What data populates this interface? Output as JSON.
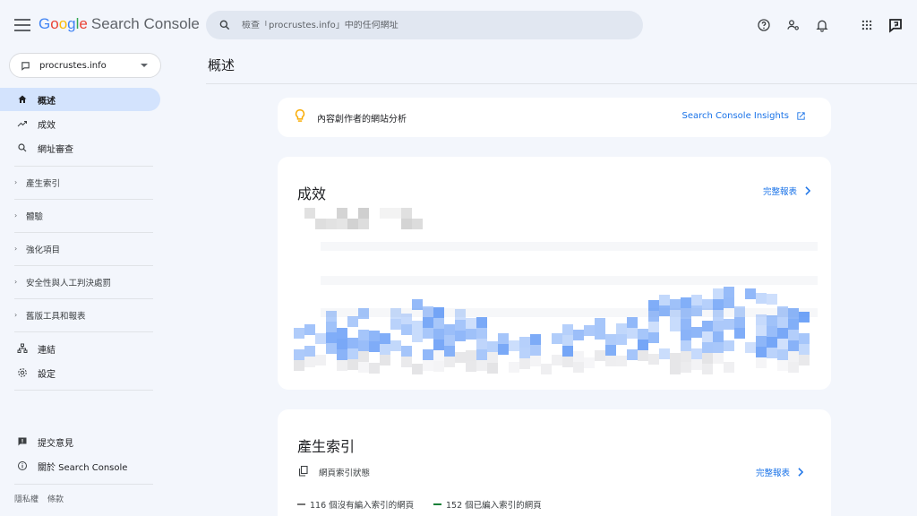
{
  "header": {
    "logo": {
      "g": "G",
      "o1": "o",
      "o2": "o",
      "g2": "g",
      "l": "l",
      "e": "e",
      "product": "Search Console"
    },
    "search_placeholder": "檢查「procrustes.info」中的任何網址",
    "icons": [
      "help-icon",
      "manage-users-icon",
      "bell-icon",
      "apps-grid-icon",
      "feedback-logo-icon"
    ]
  },
  "sidebar": {
    "property": "procrustes.info",
    "nav": [
      {
        "label": "概述",
        "icon": "home-icon",
        "active": true
      },
      {
        "label": "成效",
        "icon": "trending-up-icon"
      },
      {
        "label": "網址審查",
        "icon": "search-icon"
      }
    ],
    "groups": [
      "產生索引",
      "體驗",
      "強化項目",
      "安全性與人工判決處罰",
      "舊版工具和報表"
    ],
    "bottom_nav": [
      {
        "label": "連結",
        "icon": "links-icon"
      },
      {
        "label": "設定",
        "icon": "settings-icon"
      }
    ],
    "help_nav": [
      {
        "label": "提交意見",
        "icon": "feedback-icon"
      },
      {
        "label": "關於 Search Console",
        "icon": "info-icon"
      }
    ],
    "footer": [
      "隱私權",
      "條款"
    ]
  },
  "main": {
    "title": "概述",
    "insights": {
      "text": "內容創作者的網站分析",
      "link": "Search Console Insights"
    },
    "performance": {
      "title": "成效",
      "link": "完整報表"
    },
    "indexing": {
      "title": "產生索引",
      "subtitle": "網頁索引狀態",
      "link": "完整報表",
      "legend": [
        {
          "label": "116 個沒有編入索引的網頁",
          "color": "#757575"
        },
        {
          "label": "152 個已編入索引的網頁",
          "color": "#188038"
        }
      ]
    }
  },
  "colors": {
    "accent": "#1a73e8",
    "active_nav": "#d3e3fd",
    "background": "#f3f6fc"
  }
}
